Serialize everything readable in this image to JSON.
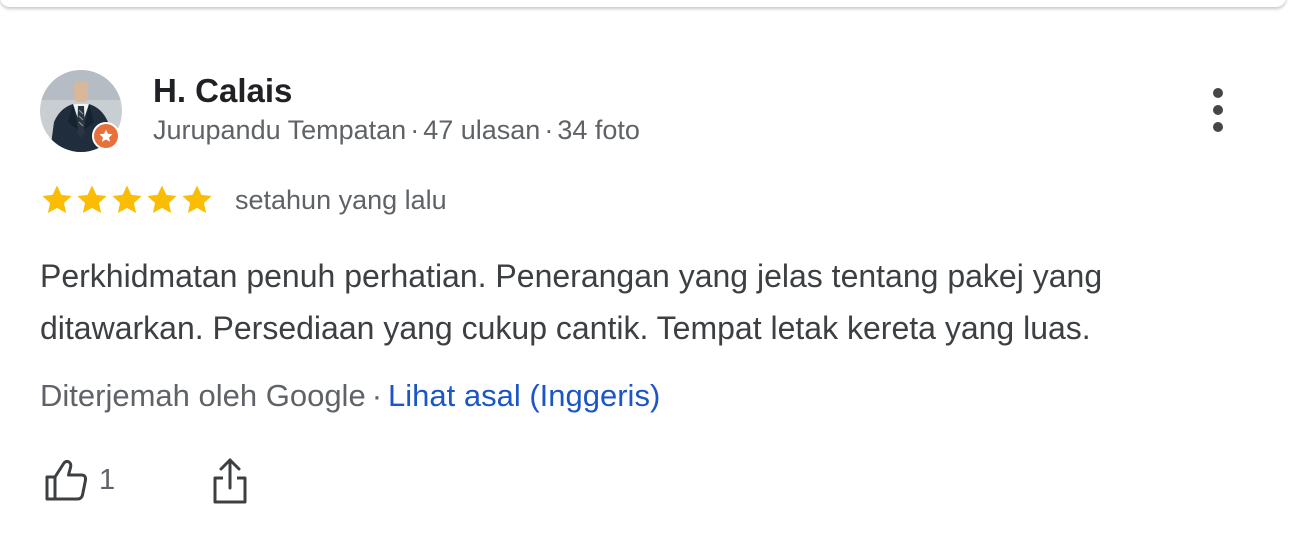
{
  "review": {
    "author": {
      "name": "H. Calais",
      "role": "Jurupandu Tempatan",
      "reviews": "47 ulasan",
      "photos": "34 foto",
      "separator": "·",
      "avatar_icon": "profile-photo-suit",
      "badge_icon": "local-guide-star-icon",
      "badge_color": "#e8703a"
    },
    "rating": {
      "stars": 5,
      "max": 5,
      "star_color": "#fbbc04"
    },
    "time_ago": "setahun yang lalu",
    "text": "Perkhidmatan penuh perhatian. Penerangan yang jelas tentang pakej yang ditawarkan. Persediaan yang cukup cantik. Tempat letak kereta yang luas.",
    "translation": {
      "note": "Diterjemah oleh Google",
      "separator": "·",
      "link": "Lihat asal (Inggeris)",
      "link_color": "#1a56c5"
    },
    "actions": {
      "like_icon": "thumb-up-icon",
      "like_count": "1",
      "share_icon": "share-icon",
      "more_icon": "more-vert-icon"
    }
  }
}
